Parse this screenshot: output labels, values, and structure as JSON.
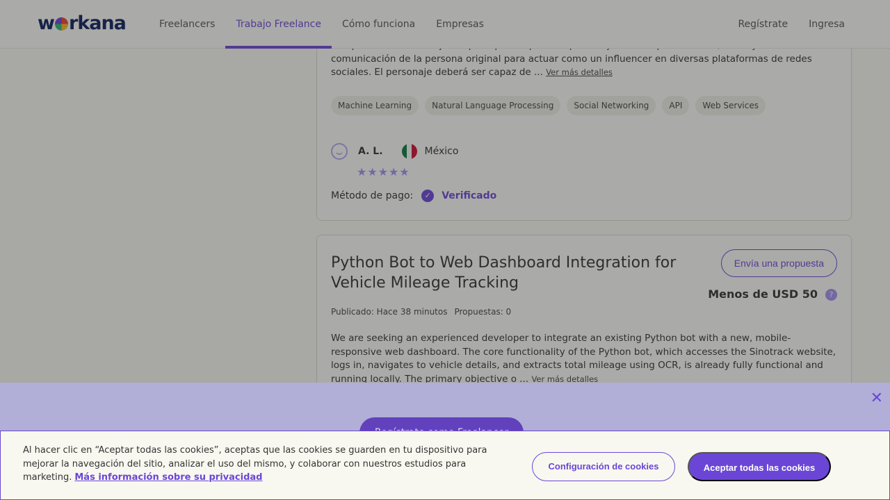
{
  "header": {
    "logo": "workana",
    "nav": [
      "Freelancers",
      "Trabajo Freelance",
      "Cómo funciona",
      "Empresas"
    ],
    "active_nav": "Trabajo Freelance",
    "right": [
      "Regístrate",
      "Ingresa"
    ]
  },
  "job1": {
    "desc_partial_top": "una persona real. El objetivo principal es que este personaje imite la personalidad, estilo y tono de",
    "desc_line2": "comunicación de la persona original para actuar como un influencer en diversas plataformas de redes",
    "desc_line3": "sociales. El personaje deberá ser capaz de ...",
    "more_label": "Ver más detalles",
    "tags": [
      "Machine Learning",
      "Natural Language Processing",
      "Social Networking",
      "API",
      "Web Services"
    ],
    "client_name": "A. L.",
    "country": "México",
    "stars": "★★★★★",
    "payment_label": "Método de pago:",
    "payment_status": "Verificado"
  },
  "job2": {
    "title": "Python Bot to Web Dashboard Integration for Vehicle Mileage Tracking",
    "proposal_button": "Envía una propuesta",
    "budget": "Menos de USD 50",
    "published": "Publicado: Hace 38 minutos",
    "proposals": "Propuestas: 0",
    "desc": "We are seeking an experienced developer to integrate an existing Python bot with a new, mobile-responsive web dashboard. The core functionality of the Python bot, which accesses the Sinotrack website, logs in, navigates to vehicle details, and extracts total mileage using OCR, is already fully functional and running locally. The primary objective o ...",
    "more_label": "Ver más detalles"
  },
  "promo": {
    "button": "Regístrate como Freelancer"
  },
  "cookie": {
    "text": "Al hacer clic en “Aceptar todas las cookies”, aceptas que las cookies se guarden en tu dispositivo para mejorar la navegación del sitio, analizar el uso del mismo, y colaborar con nuestros estudios para marketing.",
    "link": "Más información sobre su privacidad",
    "config_button": "Configuración de cookies",
    "accept_button": "Aceptar todas las cookies"
  }
}
